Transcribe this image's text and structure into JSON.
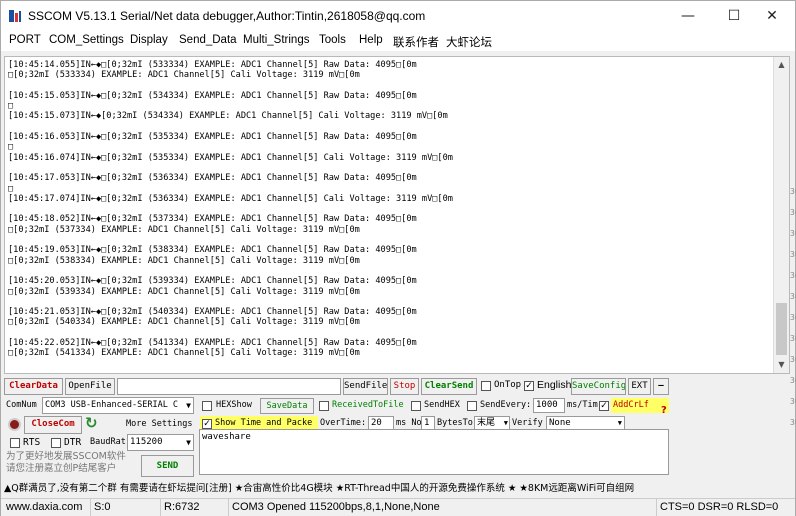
{
  "window": {
    "title": "SSCOM V5.13.1 Serial/Net data debugger,Author:Tintin,2618058@qq.com",
    "minimize_glyph": "—",
    "maximize_glyph": "☐",
    "close_glyph": "✕"
  },
  "menu": [
    "PORT",
    "COM_Settings",
    "Display",
    "Send_Data",
    "Multi_Strings",
    "Tools",
    "Help",
    "联系作者",
    "大虾论坛"
  ],
  "log": {
    "lines": [
      "[10:45:14.055]IN←◆□[0;32mI (533334) EXAMPLE: ADC1 Channel[5] Raw Data: 4095□[0m",
      "□[0;32mI (533334) EXAMPLE: ADC1 Channel[5] Cali Voltage: 3119 mV□[0m",
      "",
      "[10:45:15.053]IN←◆□[0;32mI (534334) EXAMPLE: ADC1 Channel[5] Raw Data: 4095□[0m",
      "□",
      "[10:45:15.073]IN←◆[0;32mI (534334) EXAMPLE: ADC1 Channel[5] Cali Voltage: 3119 mV□[0m",
      "",
      "[10:45:16.053]IN←◆□[0;32mI (535334) EXAMPLE: ADC1 Channel[5] Raw Data: 4095□[0m",
      "□",
      "[10:45:16.074]IN←◆□[0;32mI (535334) EXAMPLE: ADC1 Channel[5] Cali Voltage: 3119 mV□[0m",
      "",
      "[10:45:17.053]IN←◆□[0;32mI (536334) EXAMPLE: ADC1 Channel[5] Raw Data: 4095□[0m",
      "□",
      "[10:45:17.074]IN←◆□[0;32mI (536334) EXAMPLE: ADC1 Channel[5] Cali Voltage: 3119 mV□[0m",
      "",
      "[10:45:18.052]IN←◆□[0;32mI (537334) EXAMPLE: ADC1 Channel[5] Raw Data: 4095□[0m",
      "□[0;32mI (537334) EXAMPLE: ADC1 Channel[5] Cali Voltage: 3119 mV□[0m",
      "",
      "[10:45:19.053]IN←◆□[0;32mI (538334) EXAMPLE: ADC1 Channel[5] Raw Data: 4095□[0m",
      "□[0;32mI (538334) EXAMPLE: ADC1 Channel[5] Cali Voltage: 3119 mV□[0m",
      "",
      "[10:45:20.053]IN←◆□[0;32mI (539334) EXAMPLE: ADC1 Channel[5] Raw Data: 4095□[0m",
      "□[0;32mI (539334) EXAMPLE: ADC1 Channel[5] Cali Voltage: 3119 mV□[0m",
      "",
      "[10:45:21.053]IN←◆□[0;32mI (540334) EXAMPLE: ADC1 Channel[5] Raw Data: 4095□[0m",
      "□[0;32mI (540334) EXAMPLE: ADC1 Channel[5] Cali Voltage: 3119 mV□[0m",
      "",
      "[10:45:22.052]IN←◆□[0;32mI (541334) EXAMPLE: ADC1 Channel[5] Raw Data: 4095□[0m",
      "□[0;32mI (541334) EXAMPLE: ADC1 Channel[5] Cali Voltage: 3119 mV□[0m"
    ]
  },
  "right_bg_text": [
    "30",
    "30",
    "30",
    "30",
    "30",
    "30",
    "30",
    "30",
    "30",
    "30",
    "30",
    "30"
  ],
  "toolbar": {
    "clear_data": "ClearData",
    "open_file": "OpenFile",
    "send_file": "SendFile",
    "stop": "Stop",
    "clear_send": "ClearSend",
    "on_top": "OnTop",
    "english": "English",
    "save_config": "SaveConfig",
    "ext": "EXT",
    "collapse": "—"
  },
  "port_panel": {
    "com_num_label": "ComNum",
    "com_num_value": "COM3 USB-Enhanced-SERIAL C",
    "more_settings": "More Settings",
    "close_com": "CloseCom",
    "rts": "RTS",
    "dtr": "DTR",
    "baud_label": "BaudRat",
    "baud_value": "115200",
    "promo_line1": "为了更好地发展SSCOM软件",
    "promo_line2": "请您注册嘉立创P结尾客户",
    "send": "SEND"
  },
  "options": {
    "hex_show": "HEXShow",
    "save_data": "SaveData",
    "received_to_file": "ReceivedToFile",
    "send_hex": "SendHEX",
    "send_every": "SendEvery:",
    "send_every_value": "1000",
    "ms_per_time": "ms/Tim",
    "add_crlf": "AddCrLf",
    "show_time": "Show Time and Packe",
    "over_time": "OverTime:",
    "over_time_value": "20",
    "ms_no": "ms No",
    "bytes_value": "1",
    "bytes_to": "BytesTo",
    "end_value": "末尾",
    "verify": "Verify",
    "verify_value": "None"
  },
  "send_text": "waveshare",
  "ad_bar": "▲Q群满员了,没有第二个群 有需要请在虾坛提问[注册] ★合宙高性价比4G模块 ★RT-Thread中国人的开源免费操作系统 ★ ★8KM远距离WiFi可自组网",
  "status": {
    "website": "www.daxia.com",
    "s": "S:0",
    "r": "R:6732",
    "port_status": "COM3 Opened  115200bps,8,1,None,None",
    "signals": "CTS=0 DSR=0 RLSD=0"
  },
  "colors": {
    "red": "#c00000",
    "green": "#008000",
    "yellow_highlight": "#ffff66"
  }
}
